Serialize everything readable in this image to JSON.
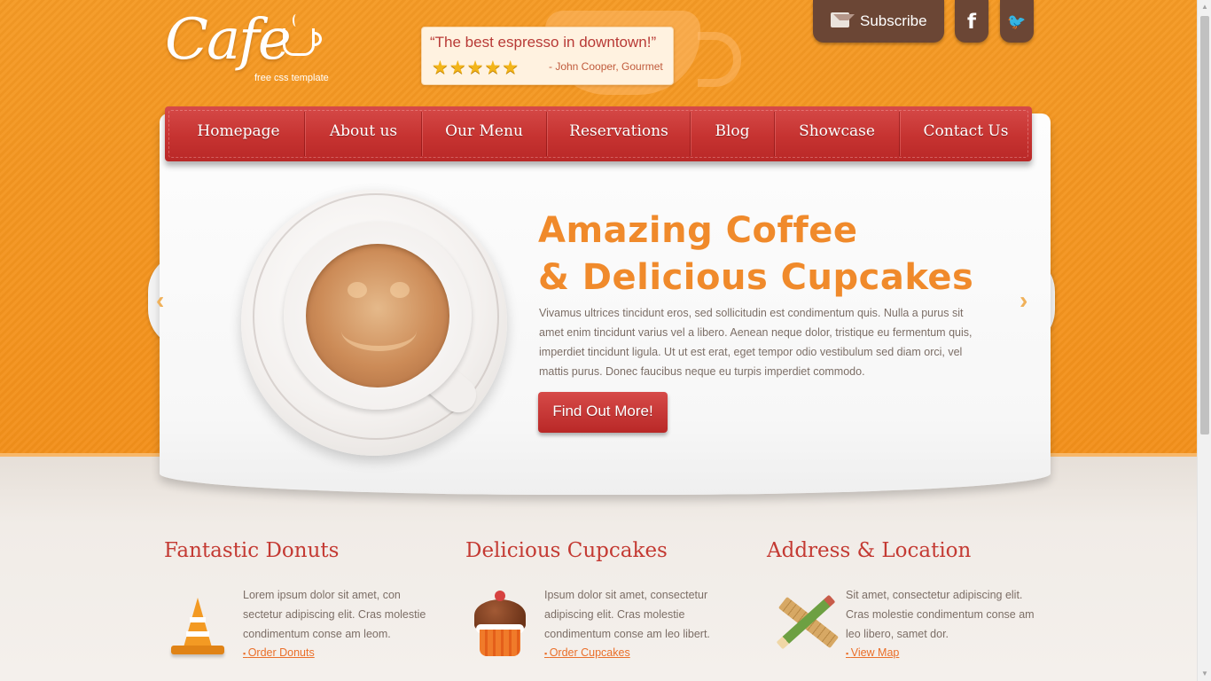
{
  "brand": {
    "name": "Cafe",
    "tagline": "free css template"
  },
  "quote": {
    "text": "“The best espresso in downtown!”",
    "rating": 5,
    "stars_display": "★★★★★",
    "author": "- John Cooper, Gourmet"
  },
  "top_actions": {
    "subscribe_label": "Subscribe",
    "facebook_glyph": "f",
    "twitter_glyph": "🐦"
  },
  "nav": {
    "items": [
      {
        "label": "Homepage"
      },
      {
        "label": "About us"
      },
      {
        "label": "Our Menu"
      },
      {
        "label": "Reservations"
      },
      {
        "label": "Blog"
      },
      {
        "label": "Showcase"
      },
      {
        "label": "Contact Us"
      }
    ]
  },
  "hero": {
    "title_line1": "Amazing Coffee",
    "title_line2": "& Delicious Cupcakes",
    "description": "Vivamus ultrices tincidunt eros, sed sollicitudin est condimentum quis. Nulla a purus sit amet enim tincidunt varius vel a libero. Aenean neque dolor, tristique eu fermentum quis, imperdiet tincidunt ligula. Ut ut est erat, eget tempor odio vestibulum sed diam orci, vel mattis purus. Donec faucibus neque eu turpis imperdiet commodo.",
    "button_label": "Find Out More!",
    "prev_arrow": "‹",
    "next_arrow": "›"
  },
  "columns": [
    {
      "title": "Fantastic Donuts",
      "text": "Lorem ipsum dolor sit amet, con sectetur adipiscing elit. Cras molestie condimentum conse am leom.",
      "link": "Order Donuts",
      "icon": "traffic-cone-icon"
    },
    {
      "title": "Delicious Cupcakes",
      "text": "Ipsum dolor sit amet, consectetur adipiscing elit. Cras molestie condimentum conse am leo libert.",
      "link": "Order Cupcakes",
      "icon": "cupcake-icon"
    },
    {
      "title": "Address & Location",
      "text": "Sit amet, consectetur adipiscing elit. Cras molestie condimentum conse am leo libero, samet dor.",
      "link": "View Map",
      "icon": "ruler-pencil-icon"
    }
  ],
  "colors": {
    "orange_bg": "#f3901b",
    "nav_red": "#c63331",
    "title_orange": "#f08a2b",
    "heading_red": "#c43a33",
    "brown": "#6b4635"
  }
}
